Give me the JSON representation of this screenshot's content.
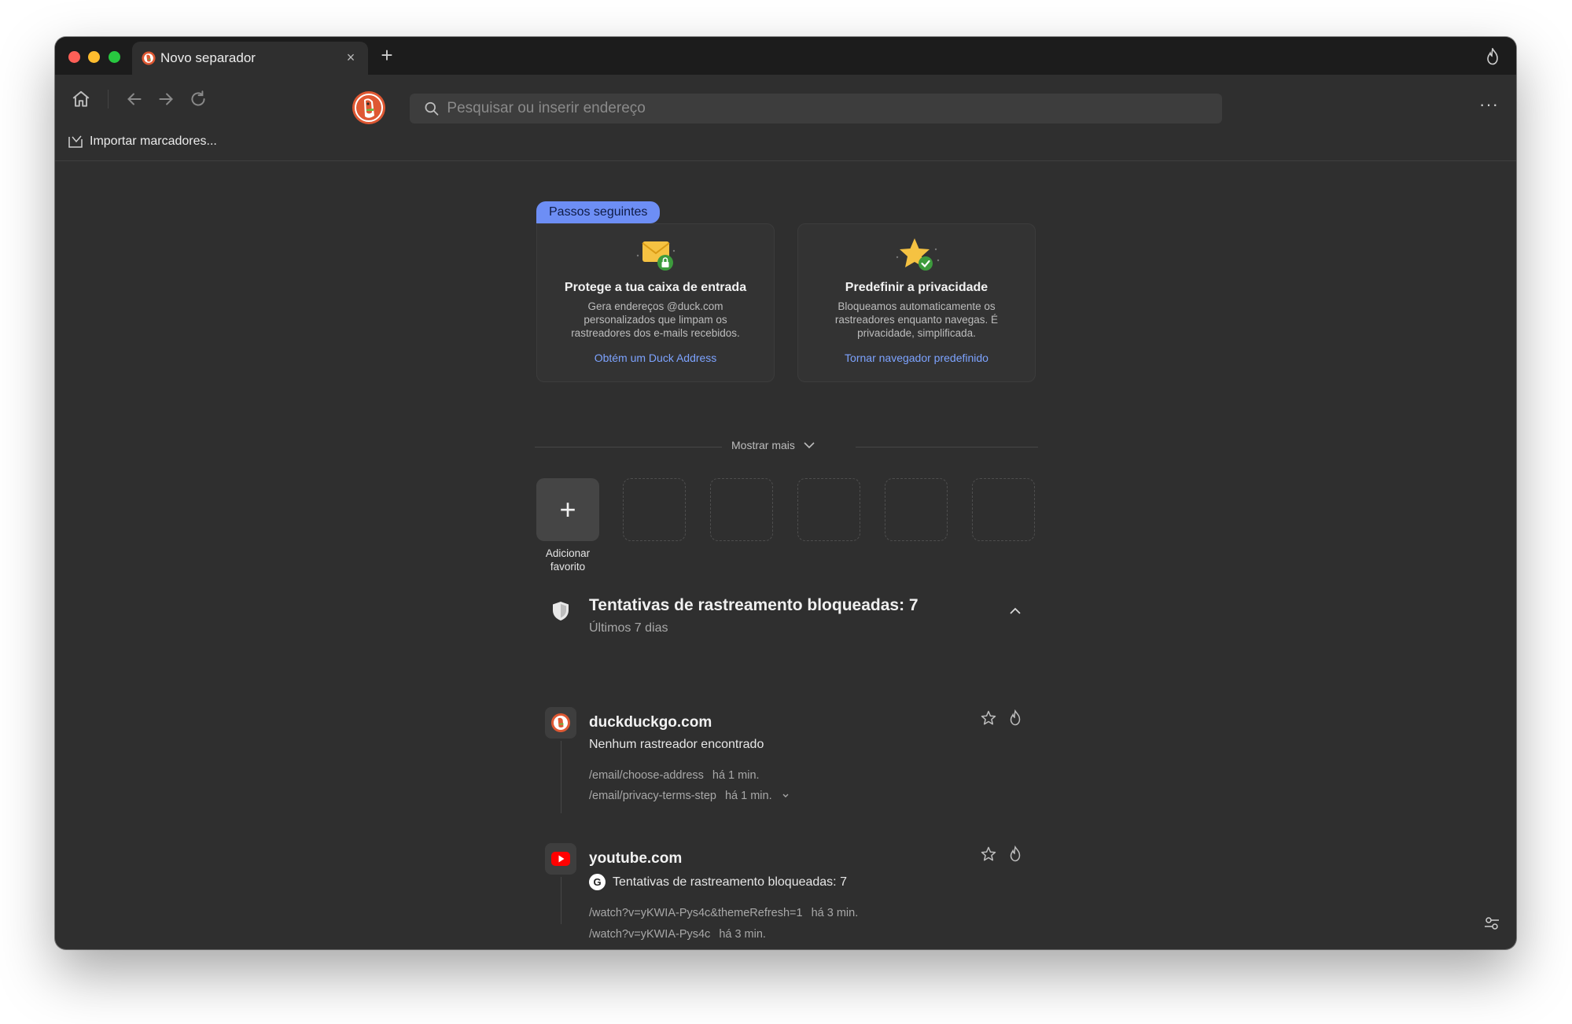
{
  "tab": {
    "title": "Novo separador",
    "close_label": "×",
    "new_tab_label": "+"
  },
  "toolbar": {
    "search_placeholder": "Pesquisar ou inserir endereço",
    "more_label": "···"
  },
  "bookmarks_bar": {
    "import_label": "Importar marcadores..."
  },
  "next_steps": {
    "badge": "Passos seguintes",
    "cards": [
      {
        "title": "Protege a tua caixa de entrada",
        "description": "Gera endereços @duck.com personalizados que limpam os rastreadores dos e-mails recebidos.",
        "link": "Obtém um Duck Address"
      },
      {
        "title": "Predefinir a privacidade",
        "description": "Bloqueamos automaticamente os rastreadores enquanto navegas. É privacidade, simplificada.",
        "link": "Tornar navegador predefinido"
      }
    ],
    "show_more": "Mostrar mais"
  },
  "favorites": {
    "add_label": "Adicionar favorito",
    "add_symbol": "+"
  },
  "tracker_stats": {
    "title": "Tentativas de rastreamento bloqueadas: 7",
    "subtitle": "Últimos 7 dias"
  },
  "sites": [
    {
      "name": "duckduckgo.com",
      "status": "Nenhum rastreador encontrado",
      "visits": [
        {
          "path": "/email/choose-address",
          "time": "há 1 min."
        },
        {
          "path": "/email/privacy-terms-step",
          "time": "há 1 min."
        }
      ]
    },
    {
      "name": "youtube.com",
      "status": "Tentativas de rastreamento bloqueadas: 7",
      "status_badge": "G",
      "visits": [
        {
          "path": "/watch?v=yKWIA-Pys4c&themeRefresh=1",
          "time": "há 3 min."
        },
        {
          "path": "/watch?v=yKWIA-Pys4c",
          "time": "há 3 min."
        }
      ]
    }
  ],
  "colors": {
    "window_bg": "#2f2f2f",
    "tabbar_bg": "#1c1c1c",
    "accent_link": "#7da3ff",
    "badge_bg": "#6d8ef5",
    "ddg_orange": "#de5833",
    "youtube_red": "#ff0000"
  },
  "icons": {
    "home": "home-icon",
    "back": "arrow-left-icon",
    "forward": "arrow-right-icon",
    "reload": "reload-icon",
    "search": "search-icon",
    "fire": "fire-icon",
    "star": "star-icon",
    "shield": "shield-icon",
    "settings": "sliders-icon"
  }
}
